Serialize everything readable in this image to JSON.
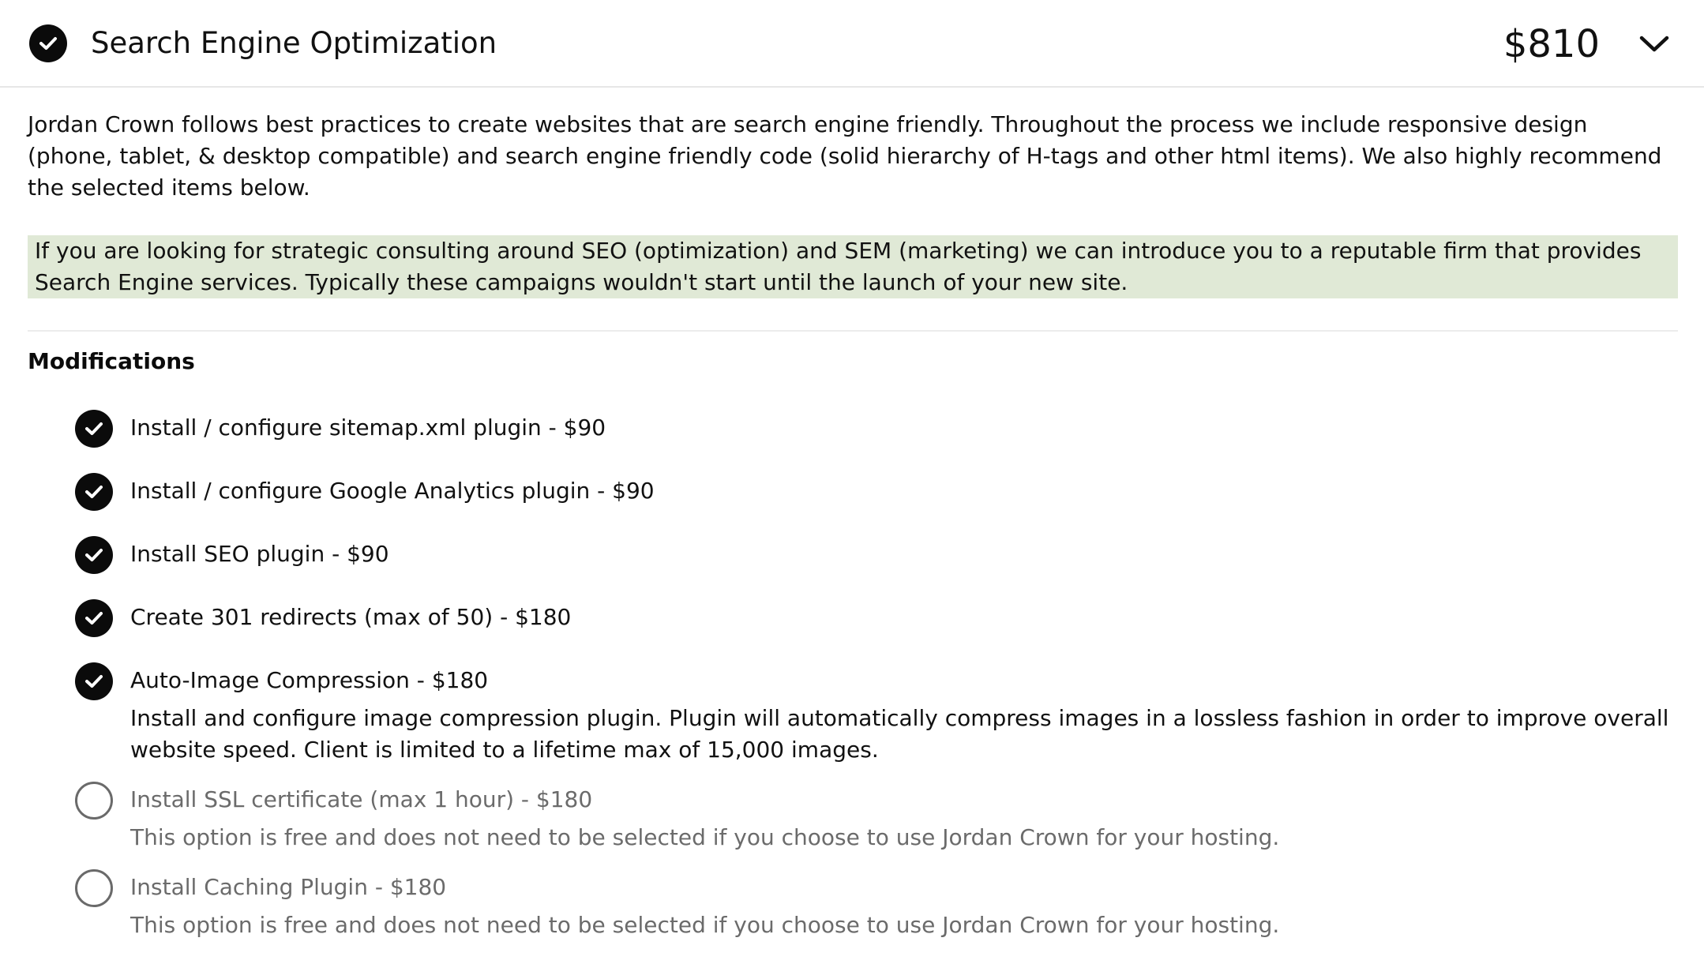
{
  "header": {
    "title": "Search Engine Optimization",
    "price": "$810",
    "check_icon": "check-circle-icon",
    "toggle_icon": "chevron-down-icon"
  },
  "intro": "Jordan Crown follows best practices to create websites that are search engine friendly. Throughout the process we include responsive design (phone, tablet, & desktop compatible) and search engine friendly code (solid hierarchy of H-tags and other html items). We also highly recommend the selected items below.",
  "note": "If you are looking for strategic consulting around SEO (optimization) and SEM (marketing) we can introduce you to a reputable firm that provides Search Engine services. Typically these campaigns wouldn't start until the launch of your new site.",
  "modifications": {
    "heading": "Modifications",
    "items": [
      {
        "label": "Install / configure sitemap.xml plugin - $90",
        "checked": true,
        "description": ""
      },
      {
        "label": "Install / configure Google Analytics plugin - $90",
        "checked": true,
        "description": ""
      },
      {
        "label": "Install SEO plugin - $90",
        "checked": true,
        "description": ""
      },
      {
        "label": "Create 301 redirects (max of 50) - $180",
        "checked": true,
        "description": ""
      },
      {
        "label": "Auto-Image Compression - $180",
        "checked": true,
        "description": "Install and configure image compression plugin. Plugin will automatically compress images in a lossless fashion in order to improve overall website speed. Client is limited to a lifetime max of 15,000 images."
      },
      {
        "label": "Install SSL certificate (max 1 hour) - $180",
        "checked": false,
        "description": "This option is free and does not need to be selected if you choose to use Jordan Crown for your hosting."
      },
      {
        "label": "Install Caching Plugin - $180",
        "checked": false,
        "description": "This option is free and does not need to be selected if you choose to use Jordan Crown for your hosting."
      }
    ]
  },
  "colors": {
    "note_background": "#e0e9d6",
    "checked": "#0b0b0b",
    "unchecked_text": "#6b6b6b"
  }
}
